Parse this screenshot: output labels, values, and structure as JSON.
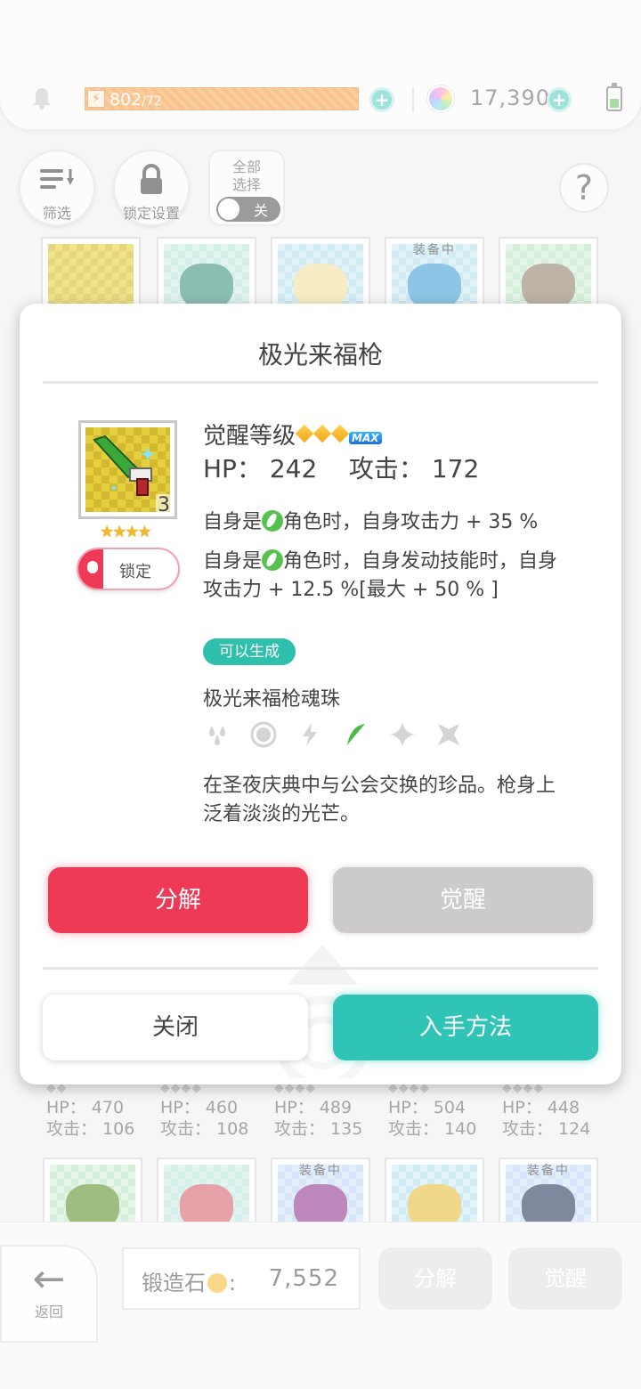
{
  "status": {
    "stamina_value": "802",
    "stamina_max": "/72",
    "gems": "17,390"
  },
  "toolbar": {
    "filter_label": "筛选",
    "lock_settings_label": "锁定设置",
    "select_all_label_1": "全部",
    "select_all_label_2": "选择",
    "select_all_state": "关"
  },
  "grid": {
    "equipped_label": "装备中",
    "stats": [
      {
        "hp": "HP： 470",
        "atk": "攻击： 106"
      },
      {
        "hp": "HP： 460",
        "atk": "攻击： 108"
      },
      {
        "hp": "HP： 489",
        "atk": "攻击： 135"
      },
      {
        "hp": "HP： 504",
        "atk": "攻击： 140"
      },
      {
        "hp": "HP： 448",
        "atk": "攻击： 124"
      }
    ]
  },
  "modal": {
    "title": "极光来福枪",
    "item_count": "3",
    "item_stars": "★★★★",
    "lock_label": "锁定",
    "awaken_label": "觉醒等级",
    "max_badge": "MAX",
    "hp_label": "HP：",
    "hp_value": "242",
    "atk_label": "攻击：",
    "atk_value": "172",
    "effect1_prefix": "自身是",
    "effect1_suffix": "角色时，自身攻击力 + 35 %",
    "effect2_prefix": "自身是",
    "effect2_line1_suffix": "角色时，自身发动技能时，自身",
    "effect2_line2": "攻击力 + 12.5 %[最大 + 50 % ]",
    "craftable_badge": "可以生成",
    "soul_name": "极光来福枪魂珠",
    "description_line1": "在圣夜庆典中与公会交换的珍品。枪身上",
    "description_line2": "泛着淡淡的光芒。",
    "dismantle_button": "分解",
    "awaken_button": "觉醒",
    "close_button": "关闭",
    "obtain_button": "入手方法"
  },
  "bottom": {
    "back_label": "返回",
    "forge_label": "锻造石",
    "forge_value": "7,552",
    "dismantle_label": "分解",
    "awaken_label": "觉醒"
  },
  "colors": {
    "accent_red": "#ee3a57",
    "accent_teal": "#2fc4b6",
    "stamina_orange": "#f4a455",
    "element_green": "#55c24e"
  }
}
